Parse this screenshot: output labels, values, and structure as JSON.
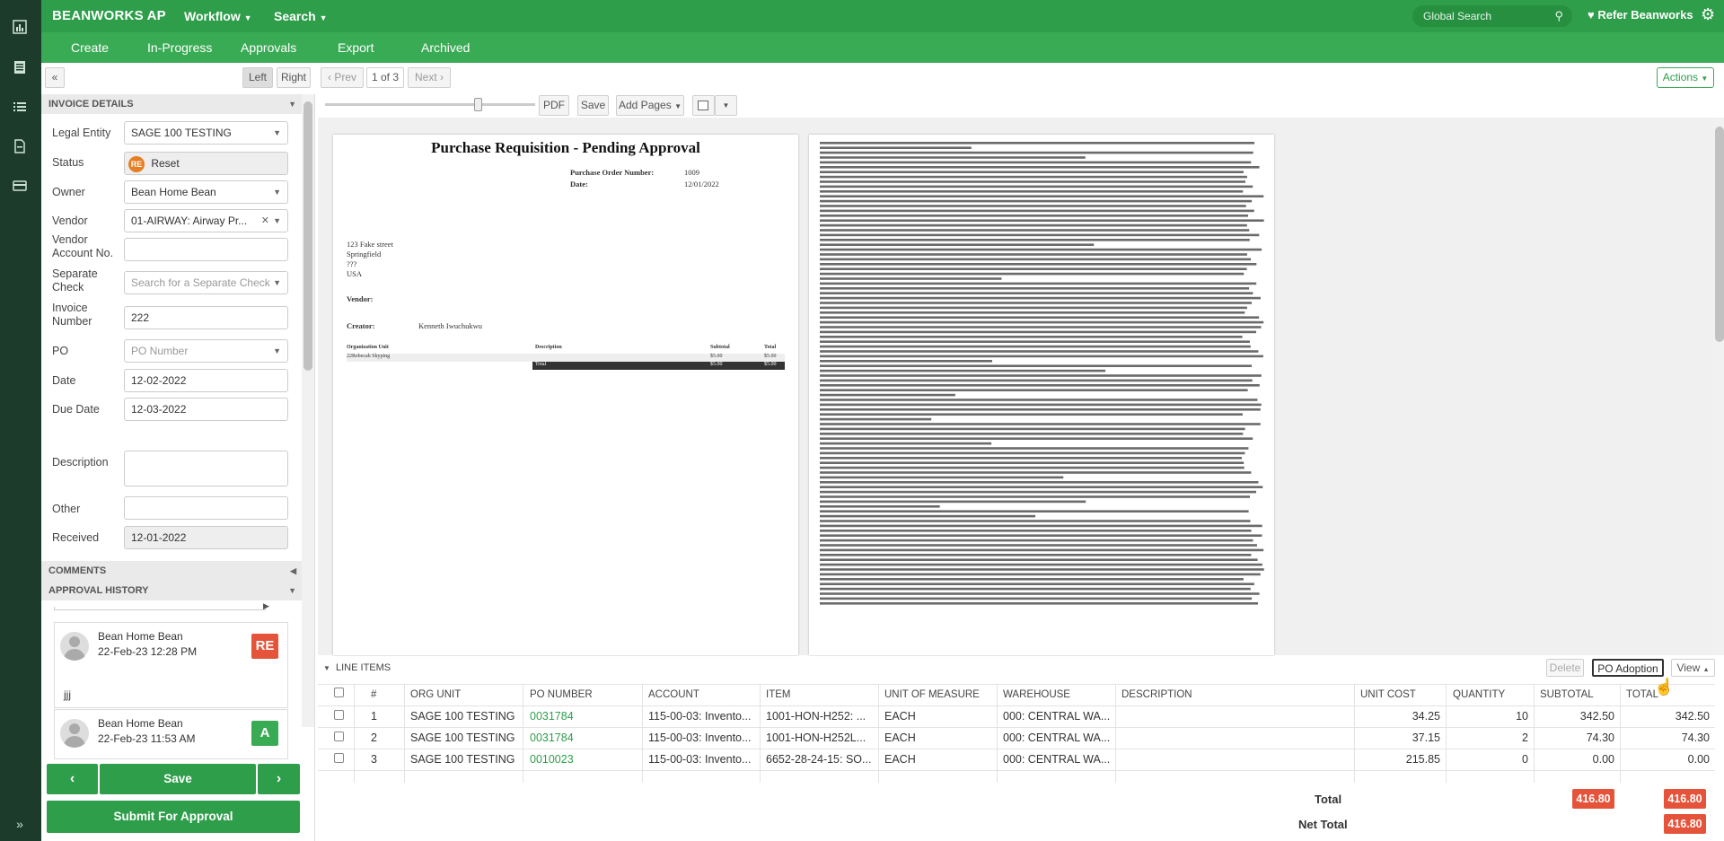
{
  "app": {
    "brand": "BEANWORKS AP",
    "menu": [
      "Workflow",
      "Search"
    ],
    "global_search_placeholder": "Global Search",
    "refer_label": "Refer Beanworks"
  },
  "subnav": [
    "Create",
    "In-Progress",
    "Approvals",
    "Export",
    "Archived"
  ],
  "toolbar": {
    "collapse": "«",
    "left": "Left",
    "right": "Right",
    "prev": "‹ Prev",
    "pager": "1 of 3",
    "next": "Next ›",
    "pdf": "PDF",
    "save": "Save",
    "add_pages": "Add Pages",
    "actions": "Actions"
  },
  "invoice_details": {
    "header": "INVOICE DETAILS",
    "fields": {
      "legal_entity": {
        "label": "Legal Entity",
        "value": "SAGE 100 TESTING"
      },
      "status": {
        "label": "Status",
        "value": "Reset",
        "badge": "RE"
      },
      "owner": {
        "label": "Owner",
        "value": "Bean Home Bean"
      },
      "vendor": {
        "label": "Vendor",
        "value": "01-AIRWAY: Airway Pr..."
      },
      "vendor_account": {
        "label": "Vendor Account No.",
        "value": ""
      },
      "separate_check": {
        "label": "Separate Check",
        "placeholder": "Search for a Separate Check"
      },
      "invoice_number": {
        "label": "Invoice Number",
        "value": "222"
      },
      "po": {
        "label": "PO",
        "placeholder": "PO Number"
      },
      "date": {
        "label": "Date",
        "value": "12-02-2022"
      },
      "due_date": {
        "label": "Due Date",
        "value": "12-03-2022"
      },
      "description": {
        "label": "Description",
        "value": ""
      },
      "other": {
        "label": "Other",
        "value": ""
      },
      "received": {
        "label": "Received",
        "value": "12-01-2022"
      }
    }
  },
  "comments_header": "COMMENTS",
  "approval_history": {
    "header": "APPROVAL HISTORY",
    "entries": [
      {
        "name": "Bean Home Bean",
        "time": "22-Feb-23 12:28 PM",
        "badge": "RE",
        "note": "jjj",
        "color": "#e5533a"
      },
      {
        "name": "Bean Home Bean",
        "time": "22-Feb-23 11:53 AM",
        "badge": "A",
        "note": "",
        "color": "#3aab55"
      }
    ]
  },
  "actions_bottom": {
    "save": "Save",
    "submit": "Submit For Approval"
  },
  "document": {
    "title": "Purchase Requisition - Pending Approval",
    "po_number_label": "Purchase Order Number:",
    "po_number": "1009",
    "date_label": "Date:",
    "date": "12/01/2022",
    "address": [
      "123 Fake street",
      "Springfield",
      "???",
      "USA"
    ],
    "vendor_label": "Vendor:",
    "creator_label": "Creator:",
    "creator": "Kenneth Iwuchukwu",
    "table_headers": [
      "Organization Unit",
      "Description",
      "Subtotal",
      "Total"
    ],
    "table_row": [
      "22Rebecah Skyping",
      "",
      "$5.00",
      "$5.00"
    ],
    "total_label": "Total",
    "total_sub": "$5.00",
    "total": "$5.00"
  },
  "line_items": {
    "header": "LINE ITEMS",
    "buttons": {
      "delete": "Delete",
      "po_adoption": "PO Adoption",
      "view": "View"
    },
    "columns": [
      "#",
      "ORG UNIT",
      "PO NUMBER",
      "ACCOUNT",
      "ITEM",
      "UNIT OF MEASURE",
      "WAREHOUSE",
      "DESCRIPTION",
      "UNIT COST",
      "QUANTITY",
      "SUBTOTAL",
      "TOTAL"
    ],
    "rows": [
      {
        "n": "1",
        "org": "SAGE 100 TESTING",
        "po": "0031784",
        "account": "115-00-03: Invento...",
        "item": "1001-HON-H252: ...",
        "uom": "EACH",
        "warehouse": "000: CENTRAL WA...",
        "desc": "",
        "unit_cost": "34.25",
        "qty": "10",
        "subtotal": "342.50",
        "total": "342.50"
      },
      {
        "n": "2",
        "org": "SAGE 100 TESTING",
        "po": "0031784",
        "account": "115-00-03: Invento...",
        "item": "1001-HON-H252L...",
        "uom": "EACH",
        "warehouse": "000: CENTRAL WA...",
        "desc": "",
        "unit_cost": "37.15",
        "qty": "2",
        "subtotal": "74.30",
        "total": "74.30"
      },
      {
        "n": "3",
        "org": "SAGE 100 TESTING",
        "po": "0010023",
        "account": "115-00-03: Invento...",
        "item": "6652-28-24-15: SO...",
        "uom": "EACH",
        "warehouse": "000: CENTRAL WA...",
        "desc": "",
        "unit_cost": "215.85",
        "qty": "0",
        "subtotal": "0.00",
        "total": "0.00"
      }
    ],
    "total_label": "Total",
    "total_sub": "416.80",
    "total": "416.80",
    "net_total_label": "Net Total",
    "net_total": "416.80"
  },
  "colors": {
    "brand_green": "#2e9e4b",
    "red": "#e5533a"
  }
}
